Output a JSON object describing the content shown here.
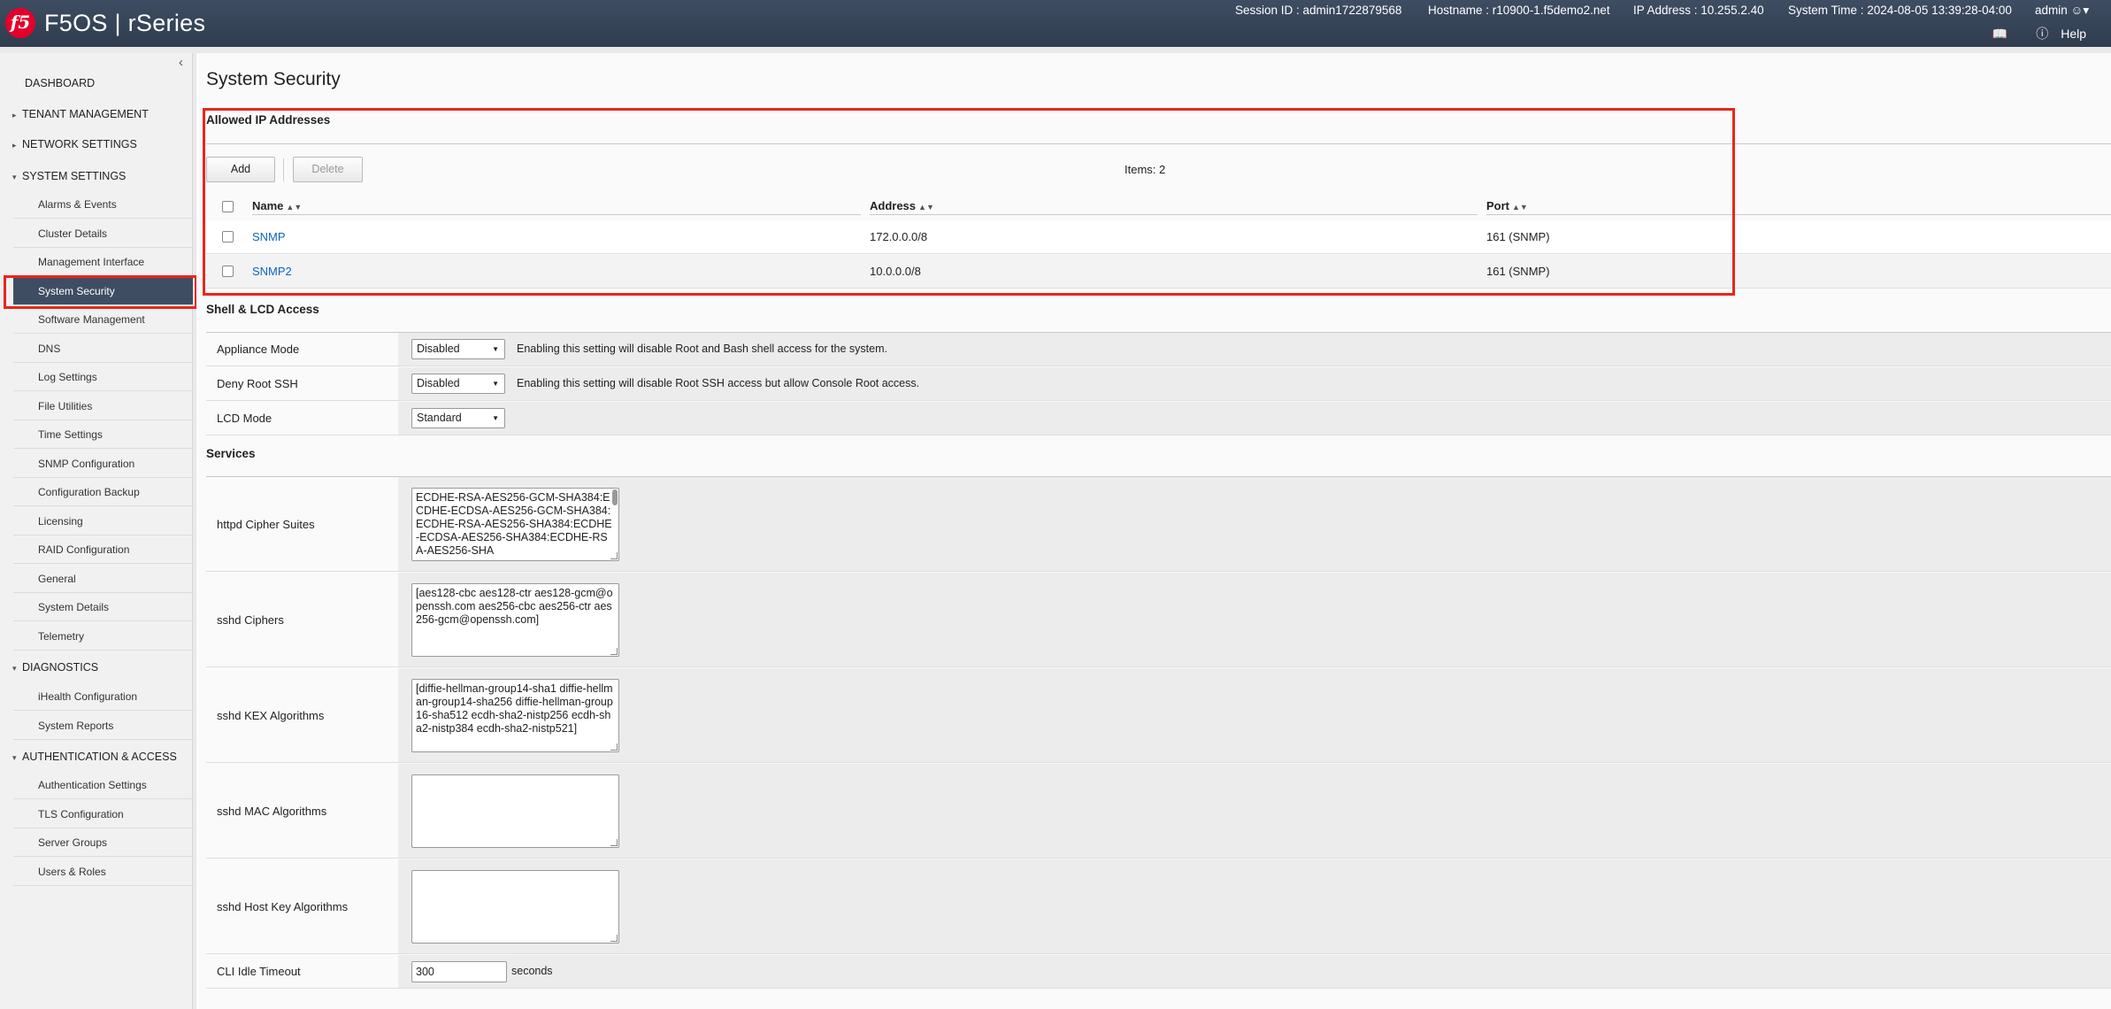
{
  "header": {
    "logo": "f5",
    "brand": "F5OS | rSeries",
    "session": "Session ID : admin1722879568",
    "hostname": "Hostname : r10900-1.f5demo2.net",
    "ip": "IP Address : 10.255.2.40",
    "time": "System Time : 2024-08-05 13:39:28-04:00",
    "user": "admin",
    "help": "Help"
  },
  "sidebar": {
    "dashboard": "DASHBOARD",
    "tenant": "TENANT MANAGEMENT",
    "network": "NETWORK SETTINGS",
    "system_settings": "SYSTEM SETTINGS",
    "system_items": [
      "Alarms & Events",
      "Cluster Details",
      "Management Interface",
      "System Security",
      "Software Management",
      "DNS",
      "Log Settings",
      "File Utilities",
      "Time Settings",
      "SNMP Configuration",
      "Configuration Backup",
      "Licensing",
      "RAID Configuration",
      "General",
      "System Details",
      "Telemetry"
    ],
    "diagnostics": "DIAGNOSTICS",
    "diag_items": [
      "iHealth Configuration",
      "System Reports"
    ],
    "auth": "AUTHENTICATION & ACCESS",
    "auth_items": [
      "Authentication Settings",
      "TLS Configuration",
      "Server Groups",
      "Users & Roles"
    ]
  },
  "main": {
    "title": "System Security",
    "allowed": {
      "title": "Allowed IP Addresses",
      "add": "Add",
      "delete": "Delete",
      "items": "Items: 2",
      "columns": [
        "Name",
        "Address",
        "Port"
      ],
      "rows": [
        {
          "name": "SNMP",
          "address": "172.0.0.0/8",
          "port": "161 (SNMP)"
        },
        {
          "name": "SNMP2",
          "address": "10.0.0.0/8",
          "port": "161 (SNMP)"
        }
      ]
    },
    "shell": {
      "title": "Shell & LCD Access",
      "appliance_label": "Appliance Mode",
      "appliance_value": "Disabled",
      "appliance_note": "Enabling this setting will disable Root and Bash shell access for the system.",
      "deny_label": "Deny Root SSH",
      "deny_value": "Disabled",
      "deny_note": "Enabling this setting will disable Root SSH access but allow Console Root access.",
      "lcd_label": "LCD Mode",
      "lcd_value": "Standard"
    },
    "services": {
      "title": "Services",
      "httpd_label": "httpd Cipher Suites",
      "httpd_value": "ECDHE-RSA-AES256-GCM-SHA384:ECDHE-ECDSA-AES256-GCM-SHA384:ECDHE-RSA-AES256-SHA384:ECDHE-ECDSA-AES256-SHA384:ECDHE-RSA-AES256-SHA",
      "ciphers_label": "sshd Ciphers",
      "ciphers_value": "[aes128-cbc aes128-ctr aes128-gcm@openssh.com aes256-cbc aes256-ctr aes256-gcm@openssh.com]",
      "kex_label": "sshd KEX Algorithms",
      "kex_value": "[diffie-hellman-group14-sha1 diffie-hellman-group14-sha256 diffie-hellman-group16-sha512 ecdh-sha2-nistp256 ecdh-sha2-nistp384 ecdh-sha2-nistp521]",
      "mac_label": "sshd MAC Algorithms",
      "mac_value": "",
      "hostkey_label": "sshd Host Key Algorithms",
      "hostkey_value": "",
      "cli_label": "CLI Idle Timeout",
      "cli_value": "300",
      "cli_unit": "seconds"
    }
  },
  "colors": {
    "header": "#3e4d62",
    "active": "#3e4d62",
    "highlight": "#e8261c",
    "link": "#0a66c2",
    "logo": "#e4002b"
  },
  "icons": [
    "collapse-chevron-icon",
    "caret-right-icon",
    "caret-down-icon",
    "sort-icon",
    "book-icon",
    "help-icon",
    "user-icon",
    "dropdown-arrow-icon"
  ]
}
